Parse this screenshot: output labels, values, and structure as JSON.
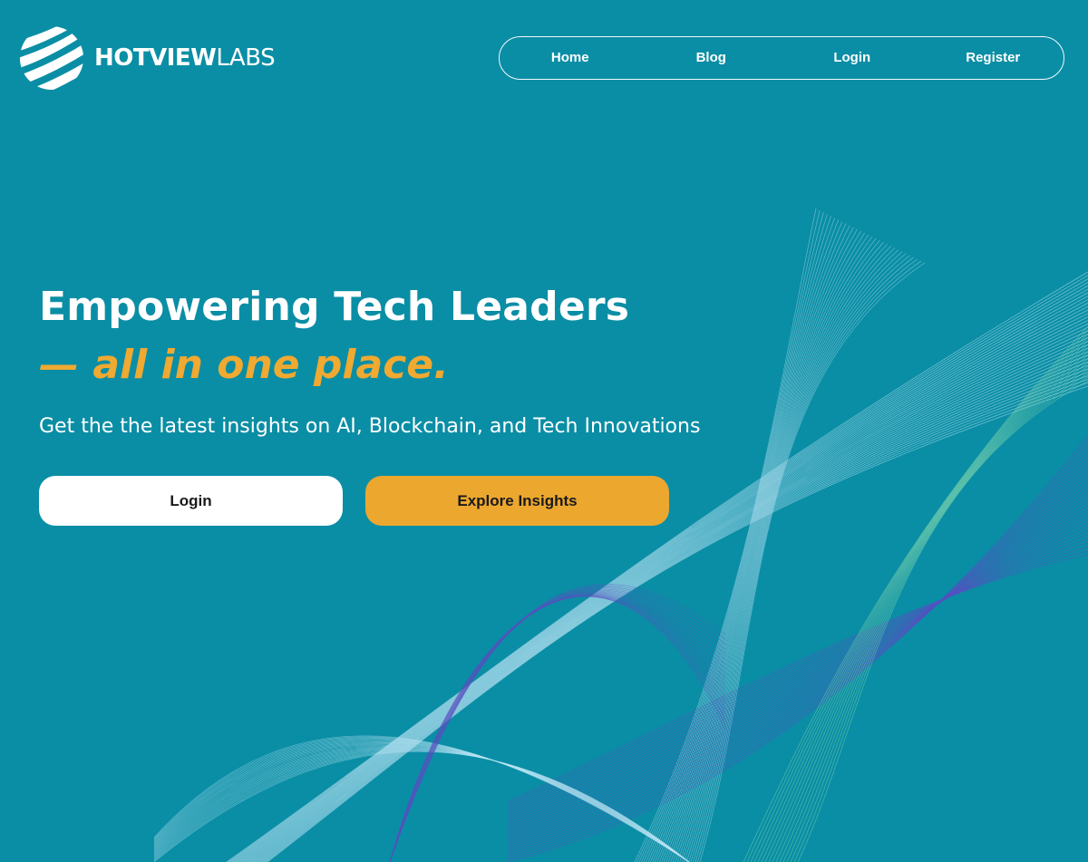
{
  "brand": {
    "name_bold": "HOTVIEW",
    "name_light": "LABS",
    "logo_icon": "striped-globe-icon"
  },
  "nav": {
    "items": [
      {
        "label": "Home"
      },
      {
        "label": "Blog"
      },
      {
        "label": "Login"
      },
      {
        "label": "Register"
      }
    ]
  },
  "hero": {
    "title": "Empowering Tech Leaders",
    "accent": "— all in one place.",
    "subtitle": "Get the the latest insights on AI, Blockchain, and Tech Innovations"
  },
  "cta": {
    "login_label": "Login",
    "explore_label": "Explore Insights"
  },
  "colors": {
    "background": "#0a8ea5",
    "accent": "#f0a931",
    "button_amber": "#eca72f",
    "button_white": "#ffffff",
    "wave_light": "#bfe6f6",
    "wave_purple": "#5a4fc2",
    "wave_green": "#8ee0b0"
  }
}
